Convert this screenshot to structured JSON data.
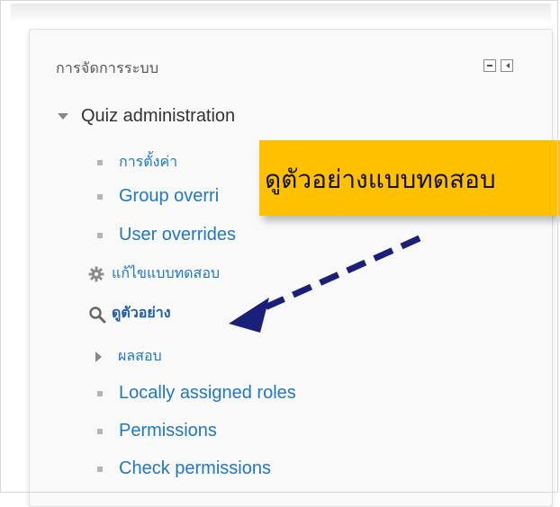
{
  "block": {
    "title": "การจัดการระบบ",
    "controls": {
      "hide_icon": "minus-box-icon",
      "dock_icon": "dock-left-icon"
    }
  },
  "tree": {
    "root": {
      "label": "Quiz administration",
      "expanded": true
    },
    "items": [
      {
        "label": "การตั้งค่า",
        "icon": "bullet"
      },
      {
        "label": "Group overri",
        "icon": "bullet"
      },
      {
        "label": "User overrides",
        "icon": "bullet"
      },
      {
        "label": "แก้ไขแบบทดสอบ",
        "icon": "gear-icon"
      },
      {
        "label": "ดูตัวอย่าง",
        "icon": "search-icon",
        "active": true
      },
      {
        "label": "ผลสอบ",
        "icon": "expand-arrow-icon"
      },
      {
        "label": "Locally assigned roles",
        "icon": "bullet"
      },
      {
        "label": "Permissions",
        "icon": "bullet"
      },
      {
        "label": "Check permissions",
        "icon": "bullet"
      }
    ]
  },
  "callout": {
    "text": "ดูตัวอย่างแบบทดสอบ",
    "background": "#ffc000",
    "arrow_color": "#1a1f7a"
  },
  "colors": {
    "link": "#1f77c7",
    "block_bg": "#f9f9f9"
  }
}
